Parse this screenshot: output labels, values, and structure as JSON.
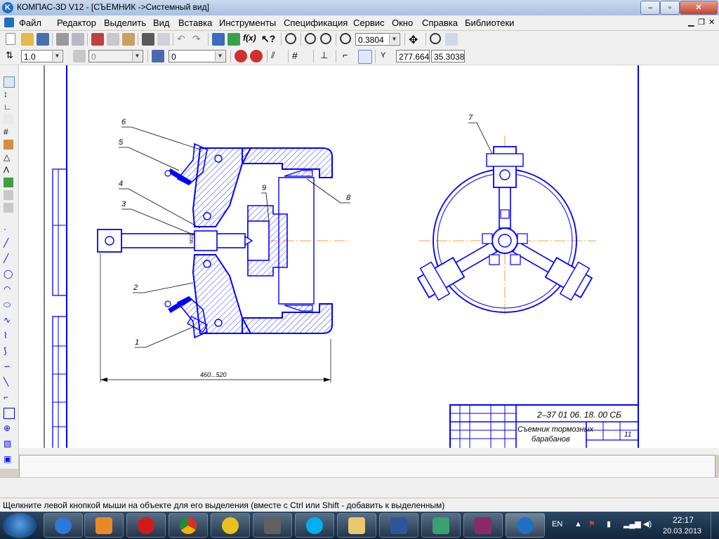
{
  "window": {
    "title": "КОМПАС-3D V12 - [СЪЕМНИК ->Системный вид]"
  },
  "menu": [
    "Файл",
    "Редактор",
    "Выделить",
    "Вид",
    "Вставка",
    "Инструменты",
    "Спецификация",
    "Сервис",
    "Окно",
    "Справка",
    "Библиотеки"
  ],
  "toolbar1": {
    "zoom_value": "0.3804"
  },
  "toolbar2": {
    "line_scale": "1.0",
    "style_value": "0",
    "layer_value": "0",
    "coord_label": "Y",
    "coord_x": "277.664",
    "coord_y": "35.3038"
  },
  "drawing": {
    "leaders": [
      "1",
      "2",
      "3",
      "4",
      "5",
      "6",
      "7",
      "8",
      "9"
    ],
    "dimension": "460...520",
    "thread_label": "M16",
    "title_block": {
      "code": "2–37 01 06. 18. 00 СБ",
      "name_line1": "Съемник тормозных",
      "name_line2": "барабанов",
      "sheet": "11"
    }
  },
  "status": {
    "hint": "Щелкните левой кнопкой мыши на объекте для его выделения (вместе с Ctrl или Shift - добавить к выделенным)"
  },
  "tray": {
    "lang": "EN",
    "time": "22:17",
    "date": "20.03.2013"
  },
  "colors": {
    "drawing_line": "#0000ff",
    "axis_line": "#ff8000",
    "taskbar": "#1b3250"
  }
}
